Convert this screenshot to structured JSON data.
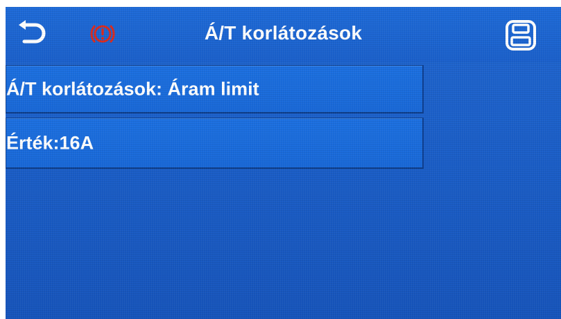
{
  "header": {
    "title": "Á/T korlátozások",
    "back_icon": "back-arrow-icon",
    "alarm_icon": "alarm-warning-icon",
    "save_icon": "save-icon"
  },
  "rows": [
    {
      "label": "Á/T korlátozások: Áram limit"
    },
    {
      "label": "Érték:16A"
    }
  ],
  "colors": {
    "background": "#1a5ec8",
    "row": "#1b6fe0",
    "alarm": "#d92b1f",
    "text": "#ffffff"
  }
}
